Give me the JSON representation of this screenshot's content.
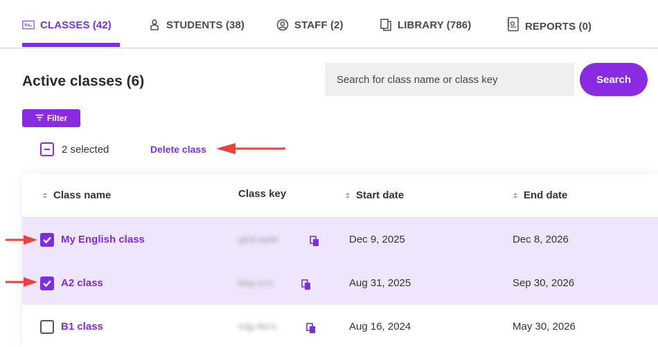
{
  "tabs": [
    {
      "label": "CLASSES (42)",
      "icon": "classes-icon",
      "active": true
    },
    {
      "label": "STUDENTS (38)",
      "icon": "student-icon",
      "active": false
    },
    {
      "label": "STAFF (2)",
      "icon": "staff-icon",
      "active": false
    },
    {
      "label": "LIBRARY (786)",
      "icon": "library-icon",
      "active": false
    },
    {
      "label": "REPORTS (0)",
      "icon": "reports-icon",
      "active": false
    }
  ],
  "header": {
    "title": "Active classes (6)",
    "search_placeholder": "Search for class name or class key",
    "search_button": "Search",
    "filter_button": "Filter"
  },
  "selection": {
    "count_text": "2 selected",
    "delete_label": "Delete class"
  },
  "table": {
    "columns": [
      "Class name",
      "Class key",
      "Start date",
      "End date"
    ],
    "rows": [
      {
        "name": "My English class",
        "key": "gfnd-xpbh",
        "start": "Dec 9, 2025",
        "end": "Dec 8, 2026",
        "selected": true
      },
      {
        "name": "A2 class",
        "key": "fdqy-zr1t",
        "start": "Aug 31, 2025",
        "end": "Sep 30, 2026",
        "selected": true
      },
      {
        "name": "B1 class",
        "key": "hdjy-fbt7c",
        "start": "Aug 16, 2024",
        "end": "May 30, 2026",
        "selected": false
      }
    ]
  },
  "colors": {
    "accent": "#7b2fe0",
    "button": "#8a2be2",
    "selected_row": "#efe6fb",
    "annotation_arrow": "#e8423b"
  }
}
